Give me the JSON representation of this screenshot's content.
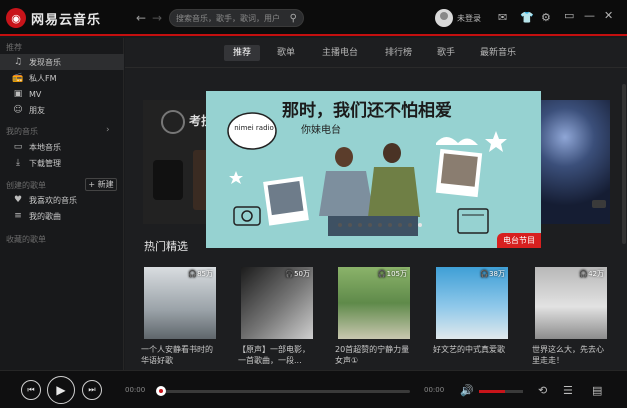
{
  "app": {
    "name": "网易云音乐"
  },
  "search": {
    "placeholder": "搜索音乐，歌手，歌词，用户"
  },
  "user": {
    "login_label": "未登录"
  },
  "sidebar": {
    "recommend_title": "推荐",
    "recommend_items": [
      {
        "label": "发现音乐",
        "icon": "music-note-icon"
      },
      {
        "label": "私人FM",
        "icon": "radio-icon"
      },
      {
        "label": "MV",
        "icon": "tv-icon"
      },
      {
        "label": "朋友",
        "icon": "friends-icon"
      }
    ],
    "my_music_title": "我的音乐",
    "my_music_items": [
      {
        "label": "本地音乐",
        "icon": "computer-icon"
      },
      {
        "label": "下载管理",
        "icon": "download-icon"
      }
    ],
    "created_title": "创建的歌单",
    "new_label": "+ 新建",
    "created_items": [
      {
        "label": "我喜欢的音乐",
        "icon": "heart-icon"
      },
      {
        "label": "我的歌曲",
        "icon": "playlist-icon"
      }
    ],
    "collected_title": "收藏的歌单"
  },
  "tabs": [
    "推荐",
    "歌单",
    "主播电台",
    "排行榜",
    "歌手",
    "最新音乐"
  ],
  "banner": {
    "headline": "那时，我们还不怕相爱",
    "subtitle": "你妹电台",
    "logo_text": "nimei radio",
    "badge": "电台节目",
    "left_peek_text": "考拉",
    "colors": {
      "bg": "#96d2d1",
      "badge": "#d7201f"
    }
  },
  "section": {
    "title": "热门精选"
  },
  "cards": [
    {
      "plays": "85万",
      "caption": "一个人安静看书时的华语好歌"
    },
    {
      "plays": "50万",
      "caption": "【原声】一部电影，一首歌曲，一段..."
    },
    {
      "plays": "105万",
      "caption": "20首超赞的宁静力量女声①"
    },
    {
      "plays": "38万",
      "caption": "好文艺的中式真爱歌"
    },
    {
      "plays": "42万",
      "caption": "世界这么大，先去心里走走！"
    }
  ],
  "player": {
    "current_time": "00:00",
    "total_time": "00:00"
  },
  "colors": {
    "accent": "#c8141a",
    "topbar": "#0c0c0c"
  }
}
